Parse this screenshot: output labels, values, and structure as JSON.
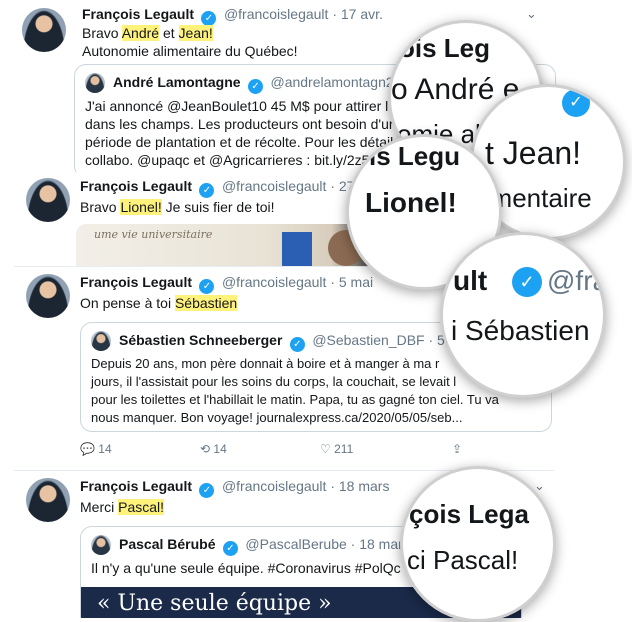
{
  "tweets": [
    {
      "name": "François Legault",
      "handle": "@francoislegault · 17 avr.",
      "line1_pre": "Bravo ",
      "hl1": "André",
      "line1_mid": " et ",
      "hl2": "Jean!",
      "line2": "Autonomie alimentaire du Québec!",
      "quote": {
        "name": "André Lamontagne",
        "handle": "@andrelamontagn2 · 1",
        "lines": [
          "J'ai annoncé @JeanBoulet10 45 M$ pour attirer les t",
          "dans les champs. Les producteurs ont besoin d'un co",
          "période de plantation et de récolte. Pour les détails d",
          "collabo. @upaqc et @Agricarrieres : bit.ly/2z5cil"
        ]
      }
    },
    {
      "name": "François Legault",
      "handle": "@francoislegault · 27 av",
      "text_pre": "Bravo ",
      "hl": "Lionel!",
      "text_post": " Je suis fier de toi!",
      "photo_text": "ume vie universitaire"
    },
    {
      "name": "François Legault",
      "handle": "@francoislegault · 5 mai",
      "text_pre": "On pense à toi ",
      "hl": "Sébastien",
      "quote": {
        "name": "Sébastien Schneeberger",
        "handle": "@Sebastien_DBF · 5 mai",
        "lines": [
          "Depuis 20 ans, mon père donnait à boire et à manger à ma r",
          "jours, il l'assistait pour les soins du corps, la couchait, se levait l",
          "pour les toilettes et l'habillait le matin. Papa, tu as gagné ton ciel. Tu va",
          "nous manquer. Bon voyage! journalexpress.ca/2020/05/05/seb..."
        ]
      },
      "actions": {
        "replies": "14",
        "retweets": "14",
        "likes": "211"
      }
    },
    {
      "name": "François Legault",
      "handle": "@francoislegault · 18 mars",
      "text_pre": "Merci ",
      "hl": "Pascal!",
      "quote": {
        "name": "Pascal Bérubé",
        "handle": "@PascalBerube · 18 mars",
        "line": "Il n'y a qu'une seule équipe. #Coronavirus #PolQc",
        "banner": "« Une seule équipe »"
      }
    }
  ],
  "magnifiers": {
    "m1": {
      "line1": "ois Leg",
      "line2": "o André e",
      "line3": "omie ali"
    },
    "m2": {
      "line1": "t Jean!",
      "line2": "limentaire"
    },
    "m3": {
      "line1": "is Legu",
      "line2": "Lionel!"
    },
    "m4": {
      "line1": "ult",
      "line2": "@fra",
      "line3": "i Sébastien"
    },
    "m5": {
      "line1": "çois Lega",
      "line2": "ci Pascal!"
    }
  },
  "colors": {
    "verified": "#1da1f2",
    "highlight": "#fff27a",
    "banner": "#1b2a49"
  },
  "icons": [
    "caret-down-icon",
    "verified-icon",
    "reply-icon",
    "retweet-icon",
    "like-icon",
    "share-icon"
  ]
}
